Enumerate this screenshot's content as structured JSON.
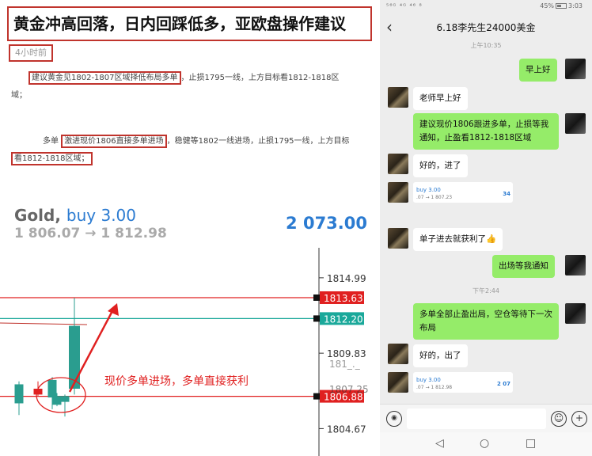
{
  "article": {
    "headline": "黄金冲高回落，日内回踩低多，亚欧盘操作建议",
    "time_ago": "4小时前",
    "para1_highlight": "建议黄金见1802-1807区域择低布局多单",
    "para1_rest": "，止损1795一线，上方目标看1812-1818区",
    "para1_end": "域；",
    "para2_prefix": "多单",
    "para2_highlight": "激进现价1806直接多单进场",
    "para2_rest": "，稳健等1802一线进场，止损1795一线，上方目标",
    "para2_highlight2": "看1812-1818区域；"
  },
  "trade": {
    "symbol": "Gold,",
    "action": "buy 3.00",
    "range": "1 806.07 → 1 812.98",
    "price": "2 073.00"
  },
  "chart_data": {
    "type": "candlestick",
    "y_ticks": [
      "1814.99",
      "1809.83",
      "1804.67"
    ],
    "badges": [
      {
        "value": "1813.63",
        "color": "#e02020"
      },
      {
        "value": "1812.20",
        "color": "#1aa89a"
      },
      {
        "value": "1806.88",
        "color": "#e02020"
      }
    ],
    "partial_tick": "1807.25",
    "partial_tick2": "181_._",
    "annotation": "现价多单进场，多单直接获利",
    "candles": [
      {
        "o": 1806.4,
        "h": 1807.9,
        "l": 1805.6,
        "c": 1807.7,
        "color": "#2a9d8f"
      },
      {
        "o": 1807.4,
        "h": 1807.9,
        "l": 1806.9,
        "c": 1807.0,
        "color": "#e02020"
      },
      {
        "o": 1806.8,
        "h": 1808.2,
        "l": 1806.0,
        "c": 1808.0,
        "color": "#2a9d8f"
      },
      {
        "o": 1806.5,
        "h": 1807.0,
        "l": 1805.5,
        "c": 1806.9,
        "color": "#2a9d8f"
      },
      {
        "o": 1806.3,
        "h": 1807.1,
        "l": 1806.2,
        "c": 1806.9,
        "color": "#2a9d8f"
      },
      {
        "o": 1807.4,
        "h": 1813.6,
        "l": 1807.0,
        "c": 1811.7,
        "color": "#2a9d8f"
      }
    ],
    "y_range": [
      1803.5,
      1816.5
    ]
  },
  "chat": {
    "status_left": "⁵⁶ᴳ ⁴ᴳ ⁴⁶ ⁸",
    "battery": "45%",
    "clock": "3:03",
    "title": "6.18李先生24000美金",
    "time1": "上午10:35",
    "time2": "下午2:44",
    "messages": [
      "早上好",
      "老师早上好",
      "建议现价1806跟进多单，止损等我通知，止盈看1812-1818区域",
      "好的，进了",
      "单子进去就获利了👍",
      "出场等我通知",
      "多单全部止盈出局，空仓等待下一次布局",
      "好的，出了"
    ],
    "card1": {
      "line1": "buy 3.00",
      "line2": ".07 → 1 807.23",
      "amount": "34"
    },
    "card2": {
      "line1": "buy 3.00",
      "line2": ".07 → 1 812.98",
      "amount": "2 07"
    }
  },
  "icons": {
    "back": "‹",
    "voice": "◉",
    "emoji": "☺",
    "plus": "+",
    "nav_back": "◁",
    "nav_home": "○",
    "nav_recent": "□"
  }
}
